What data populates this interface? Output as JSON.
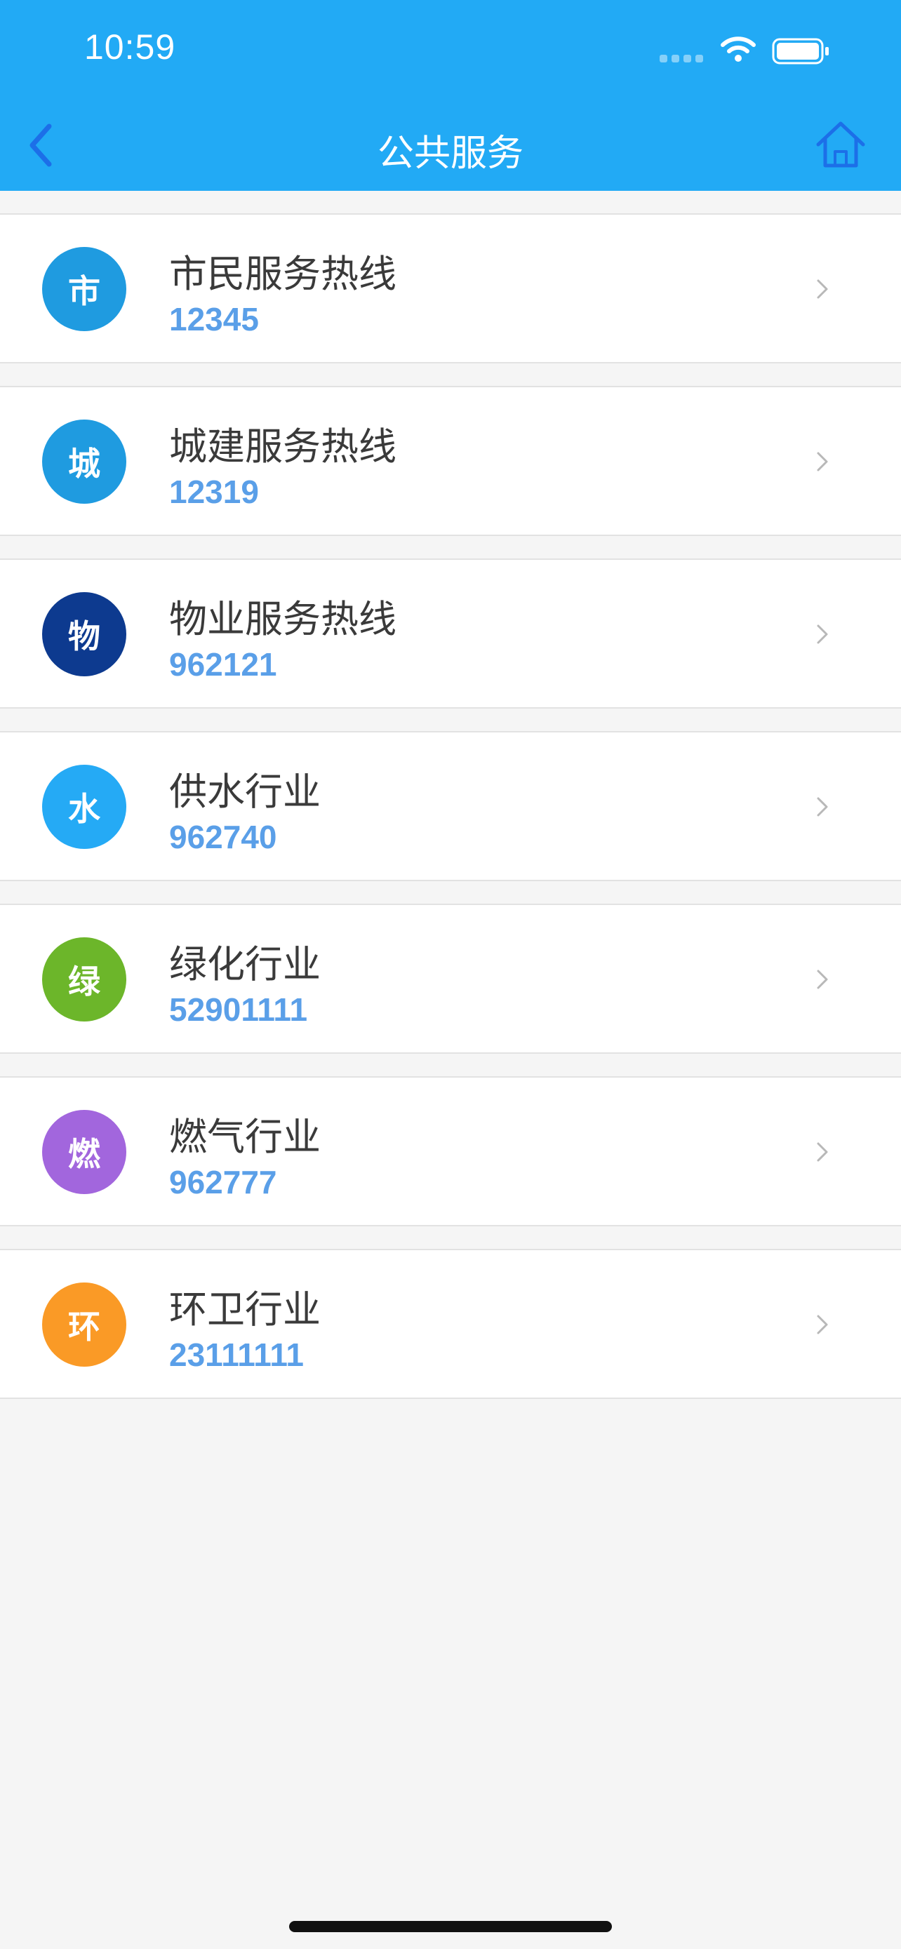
{
  "status_bar": {
    "time": "10:59"
  },
  "nav": {
    "title": "公共服务",
    "back_icon": "chevron-left-icon",
    "home_icon": "home-icon"
  },
  "colors": {
    "header": "#22aaf5",
    "number": "#5a9fe8",
    "background": "#f5f5f5"
  },
  "services": [
    {
      "icon_char": "市",
      "title": "市民服务热线",
      "number": "12345",
      "color": "#1f9be0"
    },
    {
      "icon_char": "城",
      "title": "城建服务热线",
      "number": "12319",
      "color": "#1f9be0"
    },
    {
      "icon_char": "物",
      "title": "物业服务热线",
      "number": "962121",
      "color": "#0d3a8f"
    },
    {
      "icon_char": "水",
      "title": "供水行业",
      "number": "962740",
      "color": "#25aaf5"
    },
    {
      "icon_char": "绿",
      "title": "绿化行业",
      "number": "52901111",
      "color": "#6cb62a"
    },
    {
      "icon_char": "燃",
      "title": "燃气行业",
      "number": "962777",
      "color": "#a266dd"
    },
    {
      "icon_char": "环",
      "title": "环卫行业",
      "number": "23111111",
      "color": "#fa9a26"
    }
  ]
}
